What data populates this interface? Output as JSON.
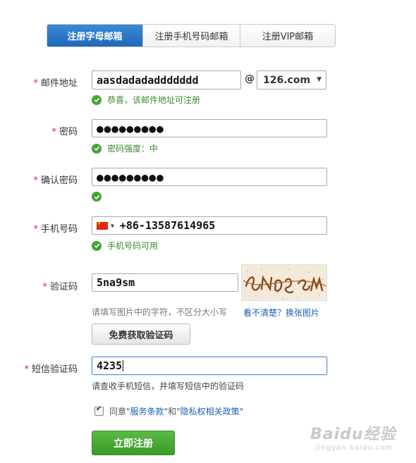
{
  "tabs": [
    {
      "label": "注册字母邮箱",
      "active": true
    },
    {
      "label": "注册手机号码邮箱",
      "active": false
    },
    {
      "label": "注册VIP邮箱",
      "active": false
    }
  ],
  "required_mark": "*",
  "email": {
    "label": "邮件地址",
    "value": "aasdadadaddddddd",
    "at": "@",
    "domain": "126.com",
    "hint": "恭喜，该邮件地址可注册"
  },
  "password": {
    "label": "密码",
    "value": "●●●●●●●●●",
    "hint": "密码强度：中"
  },
  "confirm_password": {
    "label": "确认密码",
    "value": "●●●●●●●●●"
  },
  "phone": {
    "label": "手机号码",
    "value": "+86-13587614965",
    "hint": "手机号码可用"
  },
  "captcha": {
    "label": "验证码",
    "value": "5na9sm",
    "hint": "请填写图片中的字符，不区分大小写",
    "refresh_link": "看不清楚？换张图片"
  },
  "get_sms_button": "免费获取验证码",
  "sms_code": {
    "label": "短信验证码",
    "value": "4235",
    "hint": "请查收手机短信，并填写短信中的验证码"
  },
  "agreement": {
    "prefix": "同意",
    "q1": "\"",
    "terms": "服务条款",
    "middle": "\"和\"",
    "privacy": "隐私权相关政策",
    "q2": "\"",
    "checked": true
  },
  "submit_button": "立即注册",
  "watermark": {
    "main": "Baidu经验",
    "sub": "jingyan.baidu.com"
  },
  "colors": {
    "accent_blue": "#1f68b8",
    "success_green": "#45a536",
    "required_red": "#d8262e"
  }
}
